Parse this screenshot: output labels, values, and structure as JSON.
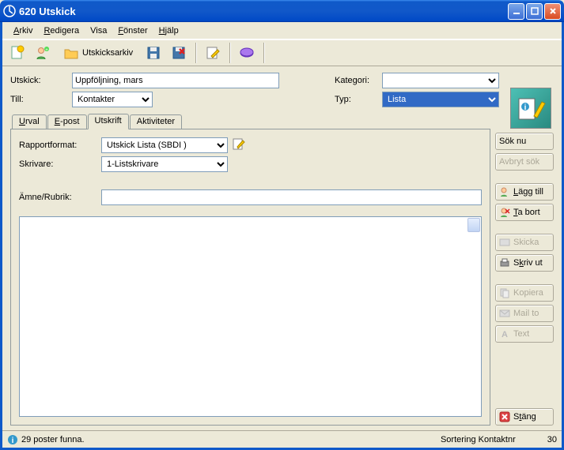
{
  "window": {
    "title": "620 Utskick"
  },
  "menu": {
    "arkiv": "Arkiv",
    "redigera": "Redigera",
    "visa": "Visa",
    "fonster": "Fönster",
    "hjalp": "Hjälp"
  },
  "toolbar": {
    "utskicksarkiv": "Utskicksarkiv"
  },
  "fields": {
    "utskick_label": "Utskick:",
    "utskick_value": "Uppföljning, mars",
    "till_label": "Till:",
    "till_value": "Kontakter",
    "kategori_label": "Kategori:",
    "kategori_value": "",
    "typ_label": "Typ:",
    "typ_value": "Lista"
  },
  "tabs": {
    "urval": "Urval",
    "epost": "E-post",
    "utskrift": "Utskrift",
    "aktiviteter": "Aktiviteter"
  },
  "panel": {
    "rapportformat_label": "Rapportformat:",
    "rapportformat_value": "Utskick Lista  (SBDI  )",
    "skrivare_label": "Skrivare:",
    "skrivare_value": "1-Listskrivare",
    "amne_label": "Ämne/Rubrik:",
    "amne_value": ""
  },
  "buttons": {
    "sok_nu": "Sök nu",
    "avbryt_sok": "Avbryt sök",
    "lagg_till": "Lägg till",
    "ta_bort": "Ta bort",
    "skicka": "Skicka",
    "skriv_ut": "Skriv ut",
    "kopiera": "Kopiera",
    "mail_to": "Mail to",
    "text": "Text",
    "stang": "Stäng"
  },
  "status": {
    "message": "29 poster funna.",
    "sort": "Sortering Kontaktnr",
    "count": "30"
  }
}
